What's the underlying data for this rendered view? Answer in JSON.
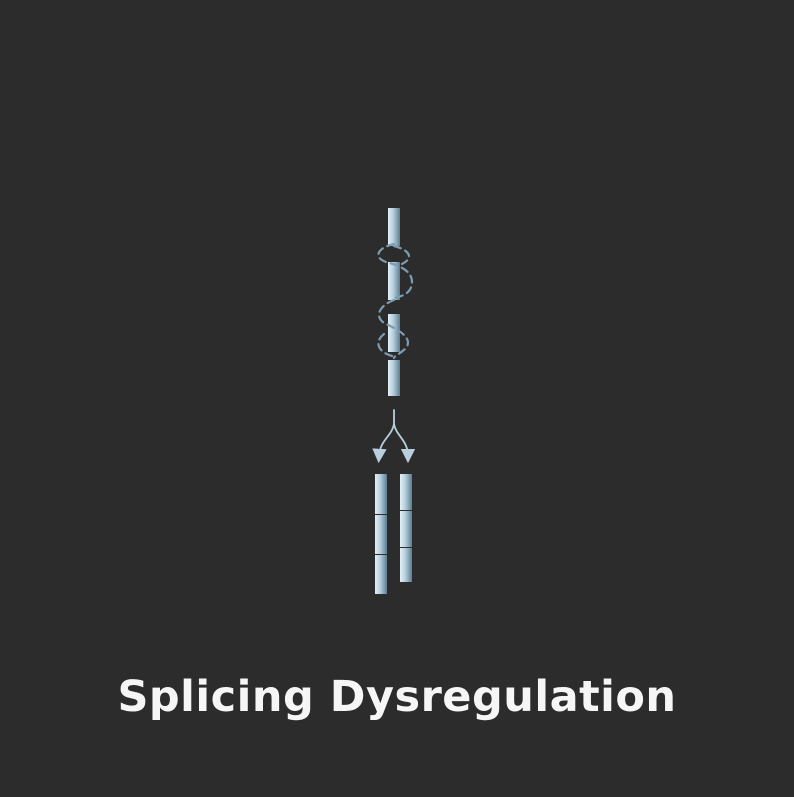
{
  "title": "Splicing Dysregulation",
  "colors": {
    "background": "#2c2c2c",
    "segment_light": "#c9dde9",
    "segment_dark": "#5d7d92",
    "arrow": "#b9cfdc",
    "title": "#f6f6f6"
  },
  "icons": {
    "pre_mrna": "pre-mrna-strand-icon",
    "splice_loops": "dashed-splice-loop-icon",
    "branch_arrow": "branch-arrow-icon",
    "isoform_a": "mrna-isoform-a-icon",
    "isoform_b": "mrna-isoform-b-icon"
  }
}
